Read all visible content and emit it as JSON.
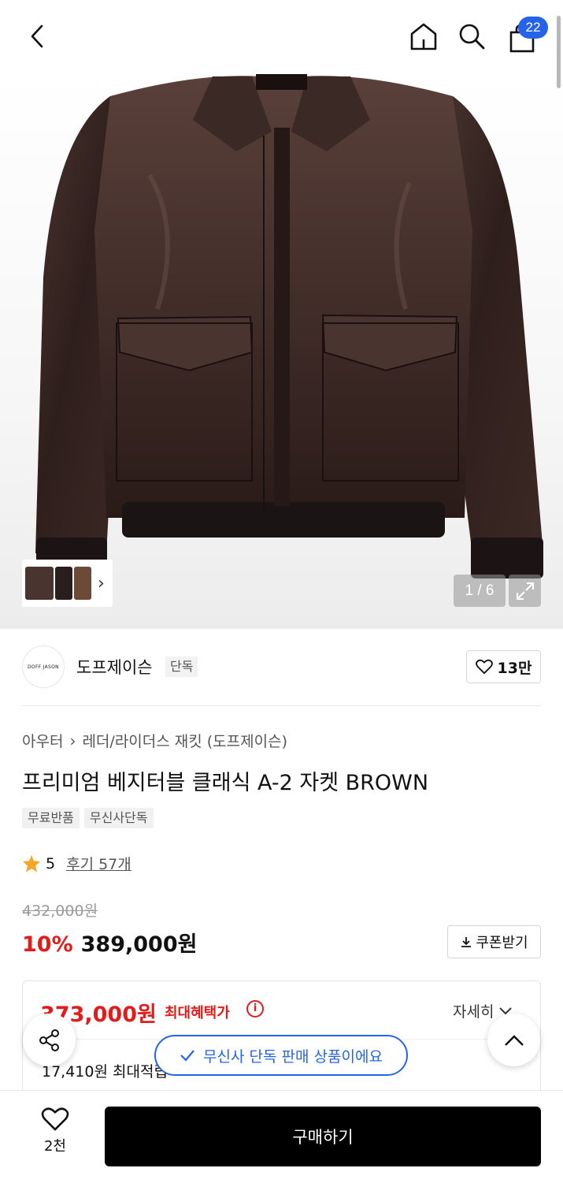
{
  "header": {
    "back_icon": "chevron-left-icon",
    "home_icon": "home-icon",
    "search_icon": "search-icon",
    "cart_icon": "shopping-bag-icon",
    "cart_count": "22"
  },
  "gallery": {
    "counter": "1 / 6",
    "expand_icon": "expand-icon",
    "thumb_arrow": "›"
  },
  "brand": {
    "logo_text": "DOFF JASON",
    "name": "도프제이슨",
    "tag": "단독",
    "likes": "13만"
  },
  "product": {
    "breadcrumb": [
      "아우터",
      "레더/라이더스 재킷 (도프제이슨)"
    ],
    "title": "프리미엄 베지터블 클래식 A-2 자켓 BROWN",
    "badges": [
      "무료반품",
      "무신사단독"
    ],
    "rating": "5",
    "review_label": "후기 57개",
    "original_price": "432,000원",
    "discount": "10%",
    "price": "389,000원",
    "coupon_label": "쿠폰받기"
  },
  "benefit": {
    "max_price": "373,000원",
    "max_label": "최대혜택가",
    "detail_label": "자세히",
    "points_text": "17,410원 최대적립"
  },
  "toast": {
    "text": "무신사 단독 판매 상품이에요"
  },
  "bottom": {
    "wish_count": "2천",
    "buy_label": "구매하기"
  },
  "colors": {
    "accent_blue": "#2563eb",
    "sale_red": "#e21b1b",
    "buy_button": "#000000",
    "star": "#f5a623"
  }
}
